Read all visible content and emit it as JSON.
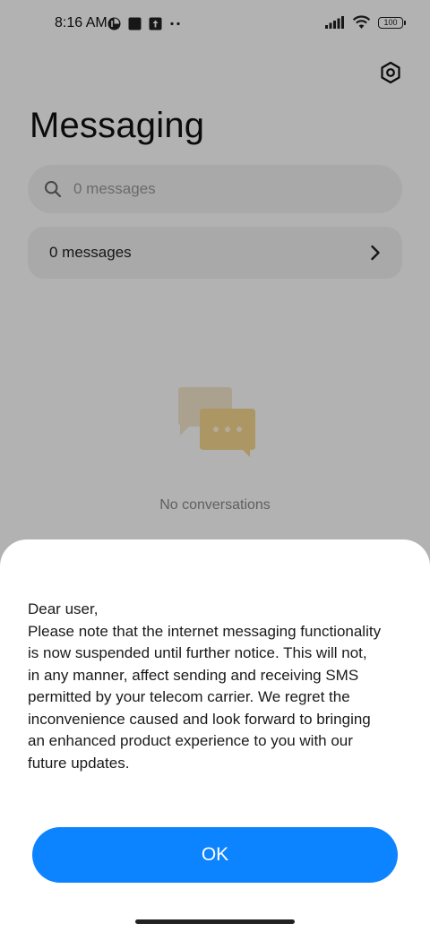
{
  "status_bar": {
    "time": "8:16 AM",
    "battery": "100"
  },
  "header": {
    "title": "Messaging",
    "settings_icon": "hexagon-gear-icon"
  },
  "search": {
    "placeholder": "0 messages",
    "icon": "search-icon"
  },
  "summary": {
    "label": "0 messages",
    "icon": "chevron-right-icon"
  },
  "empty_state": {
    "icon": "chat-bubbles-icon",
    "text": "No conversations"
  },
  "dialog": {
    "lines": [
      "Dear user,",
      "Please note that the internet messaging functionality",
      "is now suspended until further notice. This will not,",
      "in any manner, affect sending and receiving SMS",
      "permitted by your telecom carrier. We regret the",
      "inconvenience caused and look forward to bringing",
      "an enhanced product experience to you with our",
      "future updates."
    ],
    "ok_label": "OK"
  },
  "colors": {
    "accent": "#0d84ff",
    "bubble_back": "#f3e6c8",
    "bubble_front": "#f7d78f"
  }
}
